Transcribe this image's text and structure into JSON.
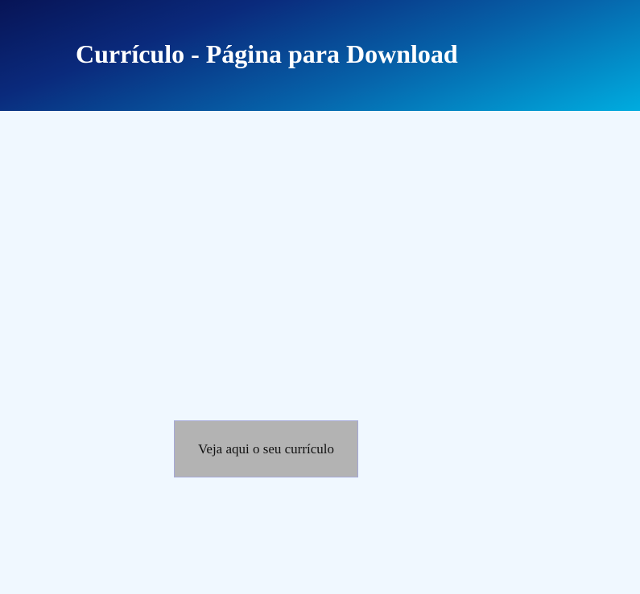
{
  "header": {
    "title": "Currículo - Página para Download"
  },
  "main": {
    "download_button_label": "Veja aqui o seu currículo"
  },
  "colors": {
    "page_background": "#f0f8ff",
    "header_gradient_start": "#071456",
    "header_gradient_end": "#00acdf",
    "button_background": "#b3b3b3",
    "button_border": "#a5a8d8"
  }
}
